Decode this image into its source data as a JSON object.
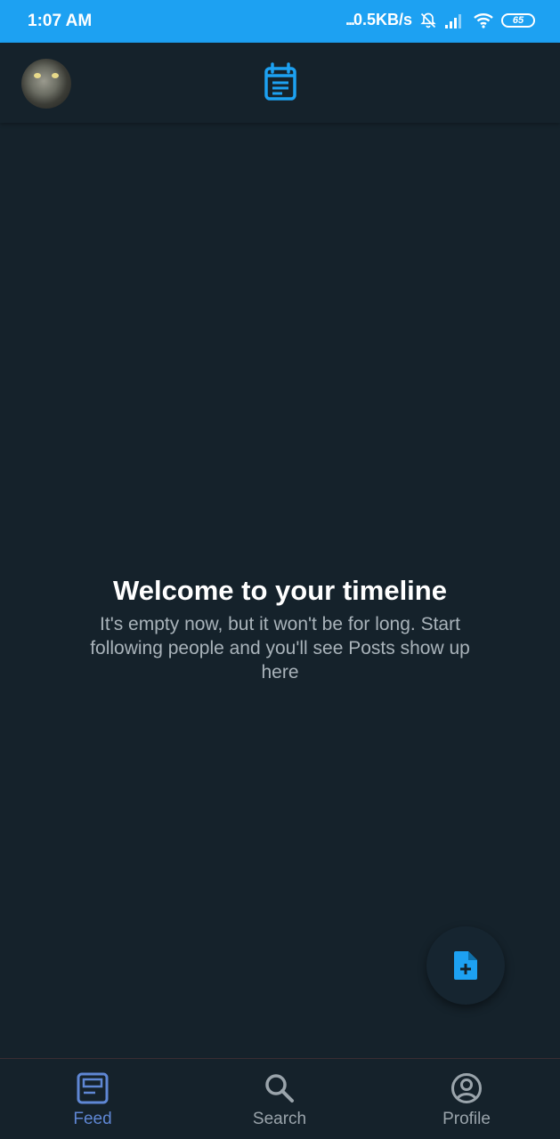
{
  "status_bar": {
    "time": "1:07 AM",
    "dots": "...",
    "network_speed": "0.5KB/s",
    "battery": "65"
  },
  "header": {
    "avatar_icon": "cat-avatar",
    "logo_icon": "feed-logo-icon"
  },
  "empty_state": {
    "title": "Welcome to your timeline",
    "body": "It's empty now, but it won't be for long. Start following people and you'll see Posts show up here"
  },
  "fab": {
    "icon": "new-post-icon"
  },
  "bottom_nav": {
    "items": [
      {
        "label": "Feed",
        "icon": "feed-icon",
        "active": true
      },
      {
        "label": "Search",
        "icon": "search-icon",
        "active": false
      },
      {
        "label": "Profile",
        "icon": "profile-icon",
        "active": false
      }
    ]
  },
  "colors": {
    "accent": "#1da1f2",
    "background": "#15222b",
    "active_tab": "#5f87d4",
    "inactive_tab": "#9aa4ab"
  }
}
